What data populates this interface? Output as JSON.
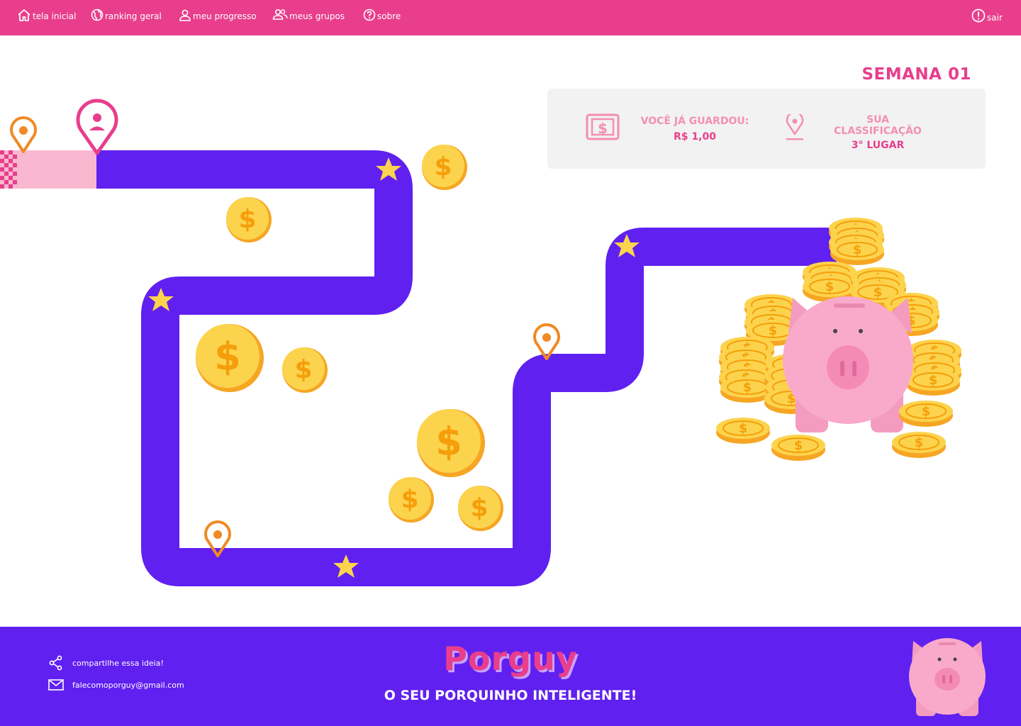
{
  "nav": {
    "items": [
      {
        "label": "tela inicial",
        "icon": "home-icon"
      },
      {
        "label": "ranking geral",
        "icon": "globe-icon"
      },
      {
        "label": "meu progresso",
        "icon": "user-icon"
      },
      {
        "label": "meus grupos",
        "icon": "group-icon"
      },
      {
        "label": "sobre",
        "icon": "help-icon"
      }
    ],
    "logout": {
      "label": "sair",
      "icon": "alert-icon"
    }
  },
  "week": {
    "title": "SEMANA 01"
  },
  "stats": {
    "saved_label": "VOCÊ JÁ GUARDOU:",
    "saved_value": "R$ 1,00",
    "rank_label": "SUA CLASSIFICAÇÃO",
    "rank_value": "3°  LUGAR"
  },
  "footer": {
    "share_label": "compartilhe essa ideia!",
    "email": "falecomoporguy@gmail.com",
    "brand": "Porguy",
    "tagline": "O SEU PORQUINHO INTELIGENTE!"
  },
  "colors": {
    "pink": "#e83e8c",
    "purple": "#6020f0",
    "gold": "#fcd34d",
    "orange": "#f59e0b",
    "light_pink": "#f9b8d0"
  }
}
